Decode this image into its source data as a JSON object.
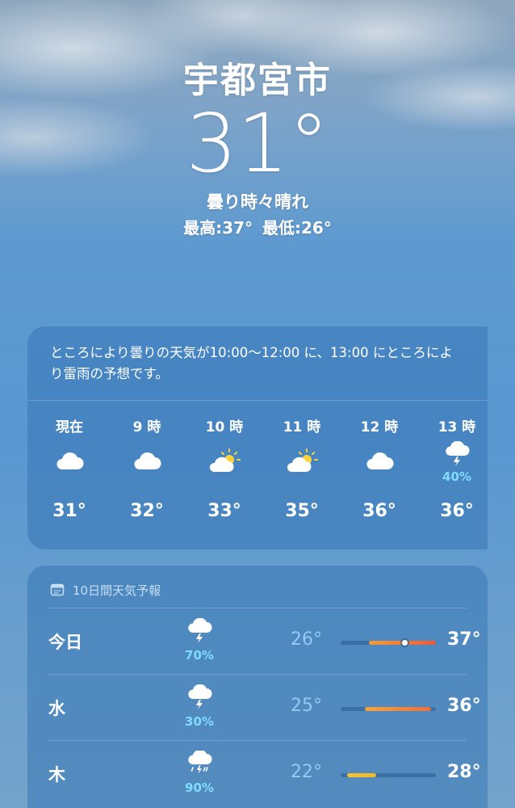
{
  "location": {
    "city": "宇都宮市",
    "temperature": "31°",
    "condition": "曇り時々晴れ",
    "high": "最高:37°",
    "low": "最低:26°"
  },
  "hourly": {
    "summary": "ところにより曇りの天気が10:00～12:00 に、13:00 にところにより雷雨の予想です。",
    "hours": [
      {
        "label": "現在",
        "icon": "cloud-icon",
        "pop": "",
        "temp": "31°"
      },
      {
        "label": "9 時",
        "icon": "cloud-icon",
        "pop": "",
        "temp": "32°"
      },
      {
        "label": "10 時",
        "icon": "partly-sunny-icon",
        "pop": "",
        "temp": "33°"
      },
      {
        "label": "11 時",
        "icon": "partly-sunny-icon",
        "pop": "",
        "temp": "35°"
      },
      {
        "label": "12 時",
        "icon": "cloud-icon",
        "pop": "",
        "temp": "36°"
      },
      {
        "label": "13 時",
        "icon": "thunderstorm-icon",
        "pop": "40%",
        "temp": "36°"
      }
    ]
  },
  "daily": {
    "title": "10日間天気予報",
    "days": [
      {
        "name": "今日",
        "icon": "thunderstorm-icon",
        "pop": "70%",
        "low": "26°",
        "high": "37°",
        "range_start": 0.3,
        "range_end": 1.0,
        "current": 0.67,
        "colors": [
          "#f39c3a",
          "#ea5a3b"
        ]
      },
      {
        "name": "水",
        "icon": "thunderstorm-icon",
        "pop": "30%",
        "low": "25°",
        "high": "36°",
        "range_start": 0.25,
        "range_end": 0.95,
        "colors": [
          "#f5a43a",
          "#ec6f3d"
        ]
      },
      {
        "name": "木",
        "icon": "thunder-rain-icon",
        "pop": "90%",
        "low": "22°",
        "high": "28°",
        "range_start": 0.07,
        "range_end": 0.37,
        "colors": [
          "#f6c233",
          "#f2b630"
        ]
      }
    ]
  }
}
